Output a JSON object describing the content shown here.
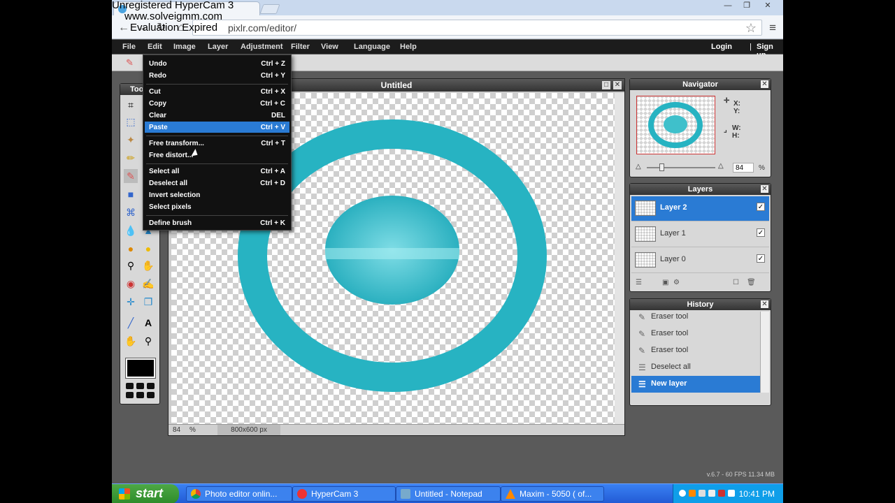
{
  "watermark": {
    "line1": "Unregistered HyperCam 3",
    "line2": "www.solveigmm.com",
    "line3": "Evaluation Expired"
  },
  "browser": {
    "url": "pixlr.com/editor/",
    "window_buttons": [
      "—",
      "❐",
      "✕"
    ]
  },
  "menubar": {
    "items": [
      "File",
      "Edit",
      "Image",
      "Layer",
      "Adjustment",
      "Filter",
      "View",
      "Language",
      "Help"
    ],
    "login": "Login",
    "separator": "|",
    "signup": "Sign up"
  },
  "tools_panel": {
    "title": "Too"
  },
  "canvas": {
    "title": "Untitled",
    "zoom": "84",
    "zoom_unit": "%",
    "size": "800x600 px",
    "ring_color": "#27b3c2",
    "disc_color": "#2fbcc8"
  },
  "edit_menu": {
    "items": [
      {
        "label": "Undo",
        "shortcut": "Ctrl + Z"
      },
      {
        "label": "Redo",
        "shortcut": "Ctrl + Y"
      },
      {
        "label": "Cut",
        "shortcut": "Ctrl + X"
      },
      {
        "label": "Copy",
        "shortcut": "Ctrl + C"
      },
      {
        "label": "Clear",
        "shortcut": "DEL"
      },
      {
        "label": "Paste",
        "shortcut": "Ctrl + V",
        "highlighted": true
      },
      {
        "label": "Free transform...",
        "shortcut": "Ctrl + T"
      },
      {
        "label": "Free distort...",
        "shortcut": ""
      },
      {
        "label": "Select all",
        "shortcut": "Ctrl + A"
      },
      {
        "label": "Deselect all",
        "shortcut": "Ctrl + D"
      },
      {
        "label": "Invert selection",
        "shortcut": ""
      },
      {
        "label": "Select pixels",
        "shortcut": ""
      },
      {
        "label": "Define brush",
        "shortcut": "Ctrl + K"
      }
    ]
  },
  "navigator": {
    "title": "Navigator",
    "x_label": "X:",
    "y_label": "Y:",
    "w_label": "W:",
    "h_label": "H:",
    "zoom": "84",
    "zoom_unit": "%"
  },
  "layers": {
    "title": "Layers",
    "items": [
      {
        "name": "Layer 2",
        "selected": true,
        "visible": true
      },
      {
        "name": "Layer 1",
        "selected": false,
        "visible": true
      },
      {
        "name": "Layer 0",
        "selected": false,
        "visible": true
      }
    ]
  },
  "history": {
    "title": "History",
    "items": [
      {
        "label": "Eraser tool",
        "selected": false
      },
      {
        "label": "Eraser tool",
        "selected": false
      },
      {
        "label": "Eraser tool",
        "selected": false
      },
      {
        "label": "Deselect all",
        "selected": false
      },
      {
        "label": "New layer",
        "selected": true
      }
    ]
  },
  "status": {
    "version": "v.6.7 - 60 FPS 11.34 MB"
  },
  "taskbar": {
    "start_label": "start",
    "tasks": [
      {
        "label": "Photo editor onlin...",
        "active": false
      },
      {
        "label": "HyperCam 3",
        "active": false
      },
      {
        "label": "Untitled - Notepad",
        "active": false
      },
      {
        "label": "Maxim - 5050 ( of...",
        "active": false
      }
    ],
    "clock": "10:41 PM"
  }
}
